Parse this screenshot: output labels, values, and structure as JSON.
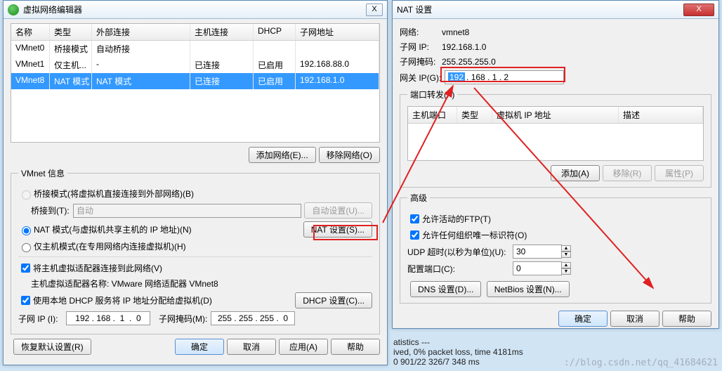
{
  "win1": {
    "title": "虚拟网络编辑器",
    "close_x": "X",
    "cols": {
      "name": "名称",
      "type": "类型",
      "ext": "外部连接",
      "host": "主机连接",
      "dhcp": "DHCP",
      "subnet": "子网地址"
    },
    "rows": [
      {
        "name": "VMnet0",
        "type": "桥接模式",
        "ext": "自动桥接",
        "host": "",
        "dhcp": "",
        "subnet": ""
      },
      {
        "name": "VMnet1",
        "type": "仅主机...",
        "ext": "-",
        "host": "已连接",
        "dhcp": "已启用",
        "subnet": "192.168.88.0"
      },
      {
        "name": "VMnet8",
        "type": "NAT 模式",
        "ext": "NAT 模式",
        "host": "已连接",
        "dhcp": "已启用",
        "subnet": "192.168.1.0"
      }
    ],
    "btn_add": "添加网络(E)...",
    "btn_remove": "移除网络(O)",
    "group": "VMnet 信息",
    "r_bridge": "桥接模式(将虚拟机直接连接到外部网络)(B)",
    "lbl_bridge_to": "桥接到(T):",
    "val_bridge_to": "自动",
    "btn_auto": "自动设置(U)...",
    "r_nat": "NAT 模式(与虚拟机共享主机的 IP 地址)(N)",
    "btn_nat": "NAT 设置(S)...",
    "r_host": "仅主机模式(在专用网络内连接虚拟机)(H)",
    "c_hostadapter": "将主机虚拟适配器连接到此网络(V)",
    "lbl_adapter": "主机虚拟适配器名称: VMware 网络适配器 VMnet8",
    "c_dhcp": "使用本地 DHCP 服务将 IP 地址分配给虚拟机(D)",
    "btn_dhcp": "DHCP 设置(C)...",
    "lbl_subip": "子网 IP (I):",
    "val_subip": "192 . 168 .  1  .  0",
    "lbl_mask": "子网掩码(M):",
    "val_mask": "255 . 255 . 255 .  0",
    "btn_restore": "恢复默认设置(R)",
    "btn_ok": "确定",
    "btn_cancel": "取消",
    "btn_apply": "应用(A)",
    "btn_help": "帮助"
  },
  "win2": {
    "title": "NAT 设置",
    "close_x": "X",
    "lbl_net": "网络:",
    "val_net": "vmnet8",
    "lbl_sub": "子网 IP:",
    "val_sub": "192.168.1.0",
    "lbl_msk": "子网掩码:",
    "val_msk": "255.255.255.0",
    "lbl_gw": "网关 IP(G):",
    "val_gw": "192 . 168  .   1   .   2",
    "gw_seg1": "192",
    "grp_pf": "端口转发(F)",
    "pf_cols": {
      "hport": "主机端口",
      "type": "类型",
      "vmip": "虚拟机 IP 地址",
      "desc": "描述"
    },
    "btn_pf_add": "添加(A)",
    "btn_pf_rm": "移除(R)",
    "btn_pf_prop": "属性(P)",
    "grp_adv": "高级",
    "c_ftp": "允许活动的FTP(T)",
    "c_org": "允许任何组织唯一标识符(O)",
    "lbl_udp": "UDP 超时(以秒为单位)(U):",
    "val_udp": "30",
    "lbl_cfgport": "配置端口(C):",
    "val_cfgport": "0",
    "btn_dns": "DNS 设置(D)...",
    "btn_nb": "NetBios 设置(N)...",
    "btn_ok": "确定",
    "btn_cancel": "取消",
    "btn_help": "帮助"
  },
  "term": {
    "l1": "atistics ---",
    "l2": "ived, 0% packet loss, time 4181ms",
    "l3": "0 901/22 326/7 348 ms"
  },
  "watermark": "://blog.csdn.net/qq_41684621"
}
